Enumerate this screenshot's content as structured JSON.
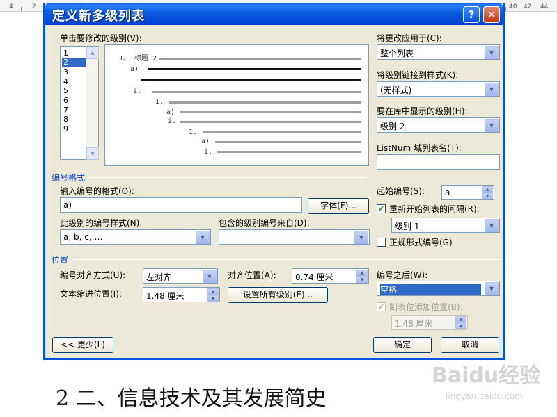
{
  "ruler": {
    "ticks": [
      "4",
      "2",
      "40",
      "42",
      "44"
    ]
  },
  "dialog": {
    "title": "定义新多级列表",
    "help_label": "?",
    "close_label": "✕",
    "select_level_label": "单击要修改的级别(V):",
    "levels": [
      "1",
      "2",
      "3",
      "4",
      "5",
      "6",
      "7",
      "8",
      "9"
    ],
    "selected_level": "2",
    "preview": {
      "rows": [
        {
          "num": "1、 标题 2"
        },
        {
          "num": "a)"
        },
        {
          "num": ""
        },
        {
          "num": "i."
        },
        {
          "num": "1."
        },
        {
          "num": "a)"
        },
        {
          "num": "i."
        },
        {
          "num": "1."
        },
        {
          "num": "a)"
        },
        {
          "num": "i."
        }
      ]
    },
    "apply_to": {
      "label": "将更改应用于(C):",
      "value": "整个列表"
    },
    "link_style": {
      "label": "将级别链接到样式(K):",
      "value": "(无样式)"
    },
    "gallery_level": {
      "label": "要在库中显示的级别(H):",
      "value": "级别 2"
    },
    "listnum": {
      "label": "ListNum 域列表名(T):",
      "value": ""
    },
    "number_format": {
      "section_label": "编号格式",
      "format_label": "输入编号的格式(O):",
      "format_value": "a)",
      "font_button": "字体(F)...",
      "style_label": "此级别的编号样式(N):",
      "style_value": "a, b, c, …",
      "include_label": "包含的级别编号来自(D):",
      "include_value": "",
      "start_label": "起始编号(S):",
      "start_value": "a",
      "restart_label": "重新开始列表的间隔(R):",
      "restart_checked": true,
      "restart_value": "级别 1",
      "legal_label": "正规形式编号(G)",
      "legal_checked": false
    },
    "position": {
      "section_label": "位置",
      "align_label": "编号对齐方式(U):",
      "align_value": "左对齐",
      "align_at_label": "对齐位置(A):",
      "align_at_value": "0.74 厘米",
      "indent_label": "文本缩进位置(I):",
      "indent_value": "1.48 厘米",
      "set_all_button": "设置所有级别(E)...",
      "follow_label": "编号之后(W):",
      "follow_value": "空格",
      "tab_stop_label": "制表位添加位置(B):",
      "tab_stop_checked": true,
      "tab_stop_value": "1.48 厘米"
    },
    "less_button": "<< 更少(L)",
    "ok_button": "确定",
    "cancel_button": "取消"
  },
  "caption": "2 二、信息技术及其发展简史",
  "watermark": {
    "text": "Baidu经验",
    "sub": "jingyan.baidu.com"
  },
  "colors": {
    "title_bar": "#0a5be0",
    "accent": "#0046d5",
    "selection": "#316ac5",
    "dialog_bg": "#ece9d8"
  }
}
